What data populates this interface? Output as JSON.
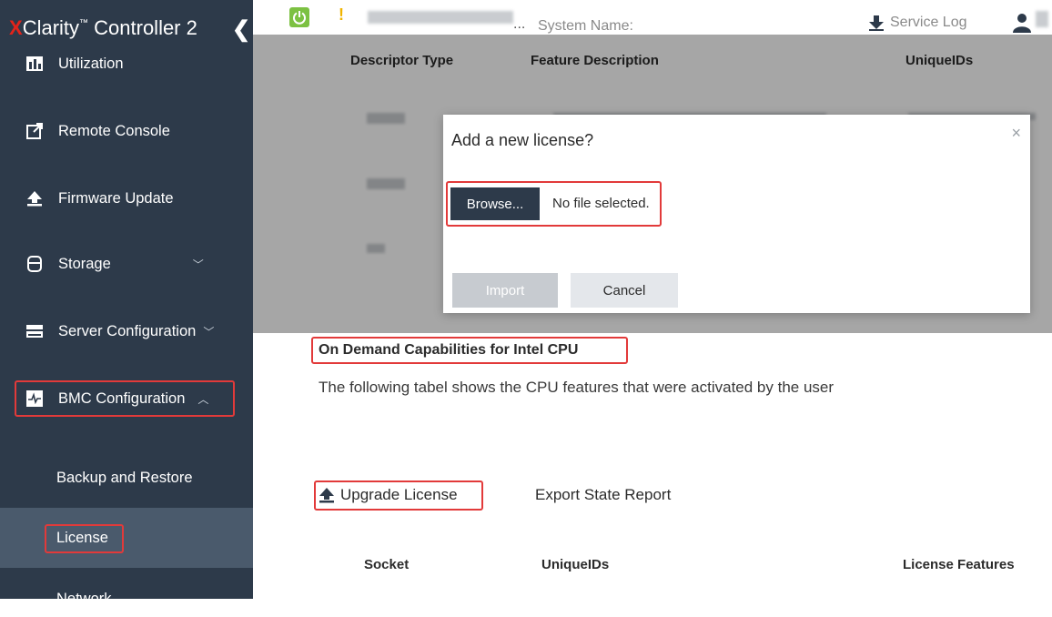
{
  "brand": {
    "prefix": "X",
    "name": "Clarity",
    "tm": "™",
    "suffix": " Controller 2",
    "collapse": "❮"
  },
  "topbar": {
    "system_name_ellipsis": "...",
    "system_name_label": "System Name:",
    "service_log": "Service Log",
    "alert": "!"
  },
  "sidebar": {
    "utilization": "Utilization",
    "remote_console": "Remote Console",
    "firmware_update": "Firmware Update",
    "storage": "Storage",
    "server_configuration": "Server Configuration",
    "bmc_configuration": "BMC Configuration",
    "backup_restore": "Backup and Restore",
    "license": "License",
    "network": "Network"
  },
  "table_top": {
    "col1": "Descriptor Type",
    "col2": "Feature Description",
    "col3": "UniqueIDs"
  },
  "section": {
    "title": "On Demand Capabilities for Intel CPU",
    "desc": "The following tabel shows the CPU features that were activated by the user"
  },
  "actions": {
    "upgrade": "Upgrade License",
    "export": "Export State Report"
  },
  "table_bottom": {
    "col1": "Socket",
    "col2": "UniqueIDs",
    "col3": "License Features"
  },
  "dialog": {
    "title": "Add a new license?",
    "close": "×",
    "browse": "Browse...",
    "no_file": "No file selected.",
    "import": "Import",
    "cancel": "Cancel"
  },
  "colors": {
    "sidebar": "#2d3a4a",
    "highlight": "#e23a3a",
    "power": "#7cc142",
    "brand_x": "#e2231a"
  }
}
